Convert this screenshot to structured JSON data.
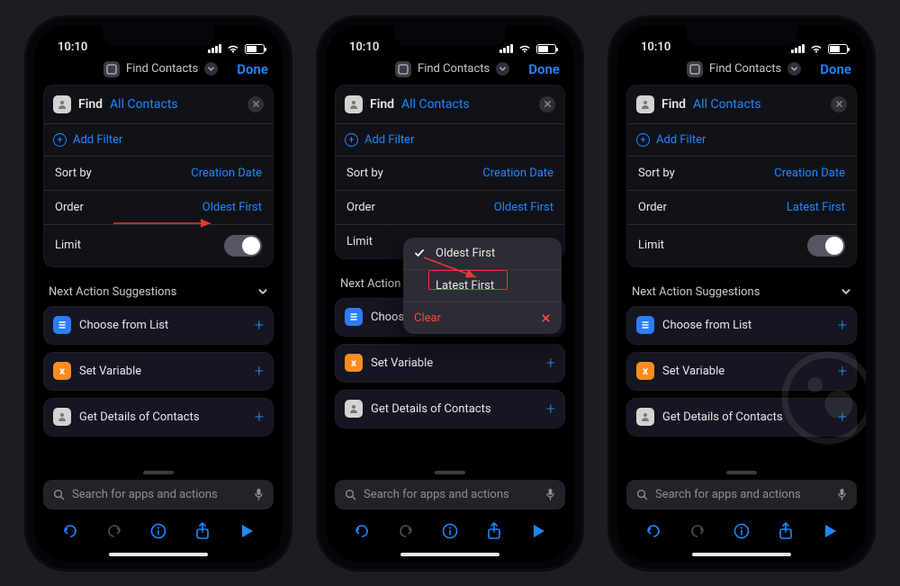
{
  "status": {
    "time": "10:10"
  },
  "header": {
    "title": "Find Contacts",
    "done": "Done"
  },
  "find": {
    "action": "Find",
    "param": "All Contacts",
    "add_filter": "Add Filter",
    "sort_label": "Sort by",
    "sort_value": "Creation Date",
    "order_label": "Order",
    "limit_label": "Limit"
  },
  "order_values": {
    "oldest": "Oldest First",
    "latest": "Latest First"
  },
  "menu": {
    "opt_checked": "Oldest First",
    "opt_other": "Latest First",
    "clear": "Clear"
  },
  "suggestions": {
    "title": "Next Action Suggestions",
    "items": [
      {
        "label": "Choose from List"
      },
      {
        "label": "Set Variable"
      },
      {
        "label": "Get Details of Contacts"
      }
    ],
    "items_short": [
      {
        "label": "Choose f..."
      }
    ]
  },
  "search": {
    "placeholder": "Search for apps and actions"
  }
}
